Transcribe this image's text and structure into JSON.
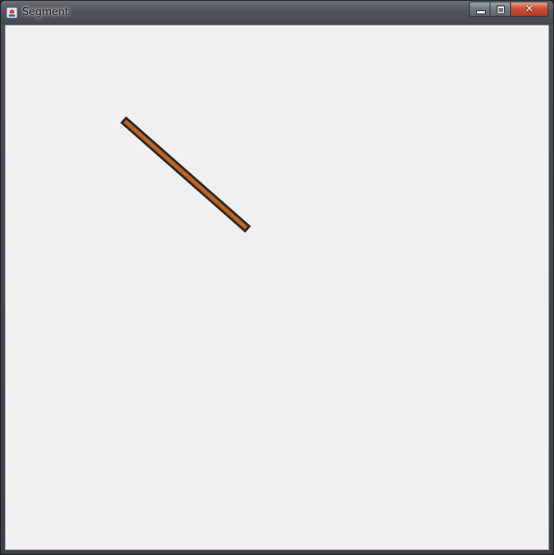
{
  "window": {
    "title": "Segment",
    "controls": {
      "minimize": "minimize",
      "maximize": "maximize",
      "close": "close"
    }
  },
  "canvas": {
    "background": "#f0f0f0",
    "segment": {
      "stroke_color": "#c0621f",
      "outline_color": "#2b2b2b"
    }
  },
  "colors": {
    "titlebar": "#4f545b",
    "close_button": "#c9503a"
  }
}
